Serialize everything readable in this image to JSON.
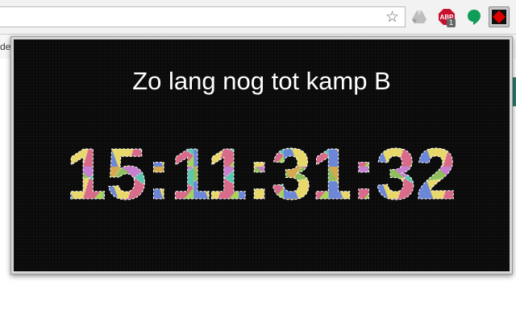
{
  "browser": {
    "bookmark_partial": "dec",
    "extensions": [
      {
        "name": "google-drive-icon"
      },
      {
        "name": "adblock-plus-icon",
        "label": "ABP",
        "badge": "1",
        "color": "#c8102e"
      },
      {
        "name": "hangouts-icon",
        "color": "#0f9d58"
      },
      {
        "name": "countdown-timer-icon",
        "color": "#e00000"
      }
    ]
  },
  "popup": {
    "title": "Zo lang nog tot kamp B",
    "countdown": "15:11:31:32",
    "background": "#0a0a0a",
    "digit_colors": [
      "#7fd36b",
      "#e8c35a",
      "#d66fc5",
      "#6c86d8",
      "#c6e25b",
      "#f0a35c",
      "#9b6bd8",
      "#5cc6d6",
      "#d85a6b",
      "#a3d35a",
      "#e8e86a",
      "#b08a5a"
    ]
  }
}
